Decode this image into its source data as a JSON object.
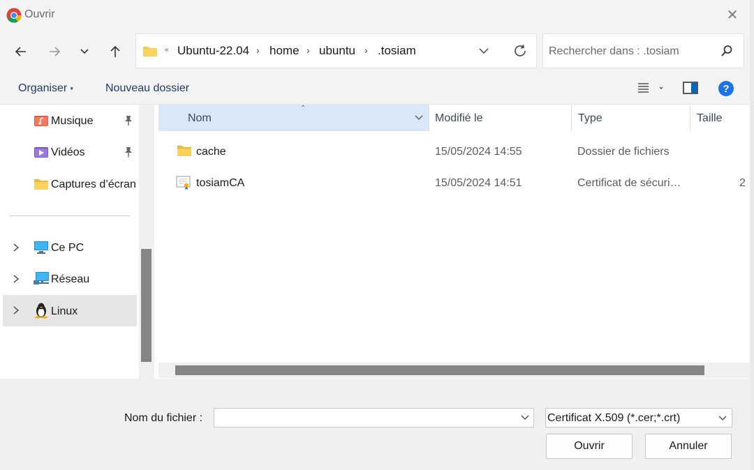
{
  "window": {
    "title": "Ouvrir"
  },
  "breadcrumb": [
    "Ubuntu-22.04",
    "home",
    "ubuntu",
    ".tosiam"
  ],
  "search": {
    "placeholder": "Rechercher dans : .tosiam"
  },
  "toolbar": {
    "organize_label": "Organiser",
    "new_folder_label": "Nouveau dossier"
  },
  "sidebar": {
    "quick_access": [
      {
        "label": "Musique",
        "icon": "music-folder-icon",
        "pinned": true
      },
      {
        "label": "Vidéos",
        "icon": "videos-folder-icon",
        "pinned": true
      },
      {
        "label": "Captures d’écran",
        "icon": "folder-icon",
        "pinned": false
      }
    ],
    "locations": [
      {
        "label": "Ce PC",
        "icon": "computer-icon"
      },
      {
        "label": "Réseau",
        "icon": "network-icon"
      },
      {
        "label": "Linux",
        "icon": "linux-penguin-icon",
        "selected": true
      }
    ]
  },
  "columns": {
    "name": "Nom",
    "modified": "Modifié le",
    "type": "Type",
    "size": "Taille"
  },
  "files": [
    {
      "name": "cache",
      "modified": "15/05/2024 14:55",
      "type": "Dossier de fichiers",
      "size": "",
      "icon": "folder-icon"
    },
    {
      "name": "tosiamCA",
      "modified": "15/05/2024 14:51",
      "type": "Certificat de sécuri…",
      "size": "2",
      "icon": "certificate-icon"
    }
  ],
  "footer": {
    "filename_label": "Nom du fichier :",
    "filename_value": "",
    "filetype_value": "Certificat X.509 (*.cer;*.crt)",
    "open_label": "Ouvrir",
    "cancel_label": "Annuler"
  },
  "colors": {
    "accent": "#0067c0",
    "selected_header": "#d9e8f6",
    "folder": "#f8c94a"
  }
}
